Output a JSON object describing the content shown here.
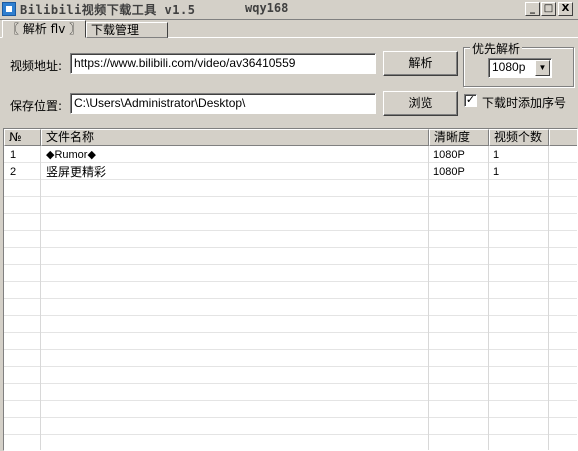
{
  "window": {
    "title": "Bilibili视频下载工具 v1.5",
    "user": "wqy168",
    "controls": {
      "minimize": "_",
      "maximize": "□",
      "close": "X"
    }
  },
  "tabs": [
    {
      "label": "〖 解析 flv 〗",
      "active": true
    },
    {
      "label": "下载管理",
      "active": false
    }
  ],
  "form": {
    "url_label": "视频地址:",
    "url_value": "https://www.bilibili.com/video/av36410559",
    "parse_button": "解析",
    "save_label": "保存位置:",
    "save_value": "C:\\Users\\Administrator\\Desktop\\",
    "browse_button": "浏览",
    "priority_group": "优先解析",
    "priority_selected": "1080p",
    "add_index_checked": true,
    "add_index_label": "下载时添加序号"
  },
  "table": {
    "headers": [
      "№",
      "文件名称",
      "清晰度",
      "视频个数"
    ],
    "rows": [
      {
        "no": "1",
        "name": "◆Rumor◆",
        "quality": "1080P",
        "count": "1"
      },
      {
        "no": "2",
        "name": "竖屏更精彩",
        "quality": "1080P",
        "count": "1"
      }
    ]
  },
  "icons": {
    "app": "app-icon",
    "dropdown": "chevron-down-icon",
    "check": "checkmark-icon"
  },
  "colors": {
    "window_bg": "#d4d0c8",
    "list_bg": "#ffffff",
    "app_icon": "#2f7fd0"
  }
}
